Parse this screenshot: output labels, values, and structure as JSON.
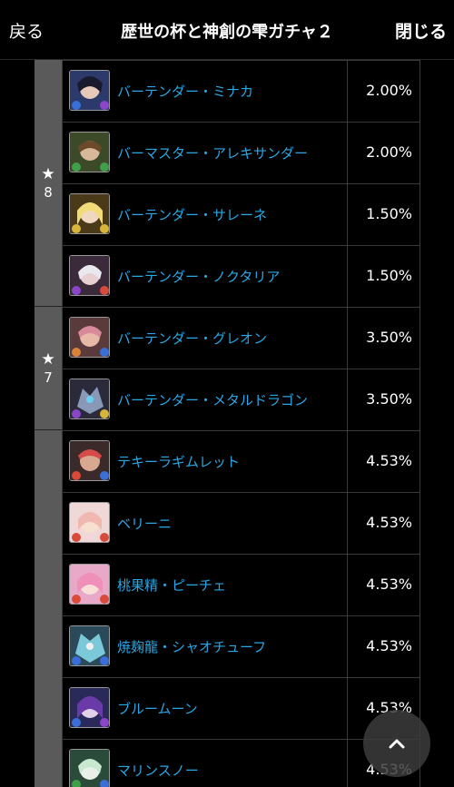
{
  "header": {
    "back_label": "戻る",
    "title": "歴世の杯と神創の雫ガチャ２",
    "close_label": "閉じる"
  },
  "groups": [
    {
      "rarity_star": "★",
      "rarity_num": "8"
    },
    {
      "rarity_star": "★",
      "rarity_num": "7"
    },
    {
      "rarity_star": "",
      "rarity_num": ""
    }
  ],
  "rows": [
    {
      "name": "バーテンダー・ミナカ",
      "rate": "2.00%",
      "icon": "minaka-icon",
      "color": "#3a6fd8"
    },
    {
      "name": "バーマスター・アレキサンダー",
      "rate": "2.00%",
      "icon": "alexander-icon",
      "color": "#3fa04a"
    },
    {
      "name": "バーテンダー・サレーネ",
      "rate": "1.50%",
      "icon": "salene-icon",
      "color": "#d8b53a"
    },
    {
      "name": "バーテンダー・ノクタリア",
      "rate": "1.50%",
      "icon": "noctaria-icon",
      "color": "#8a45c8"
    },
    {
      "name": "バーテンダー・グレオン",
      "rate": "3.50%",
      "icon": "greon-icon",
      "color": "#d8823a"
    },
    {
      "name": "バーテンダー・メタルドラゴン",
      "rate": "3.50%",
      "icon": "metal-dragon-icon",
      "color": "#8a45c8"
    },
    {
      "name": "テキーラギムレット",
      "rate": "4.53%",
      "icon": "tequila-gimlet-icon",
      "color": "#d84a3a"
    },
    {
      "name": "ベリーニ",
      "rate": "4.53%",
      "icon": "bellini-icon",
      "color": "#d84a3a"
    },
    {
      "name": "桃果精・ピーチェ",
      "rate": "4.53%",
      "icon": "peche-icon",
      "color": "#d84a3a"
    },
    {
      "name": "焼麹龍・シャオチューフ",
      "rate": "4.53%",
      "icon": "xiaochufu-icon",
      "color": "#3a6fd8"
    },
    {
      "name": "ブルームーン",
      "rate": "4.53%",
      "icon": "blue-moon-icon",
      "color": "#3a6fd8"
    },
    {
      "name": "マリンスノー",
      "rate": "4.53%",
      "icon": "marine-snow-icon",
      "color": "#3fa04a"
    }
  ]
}
